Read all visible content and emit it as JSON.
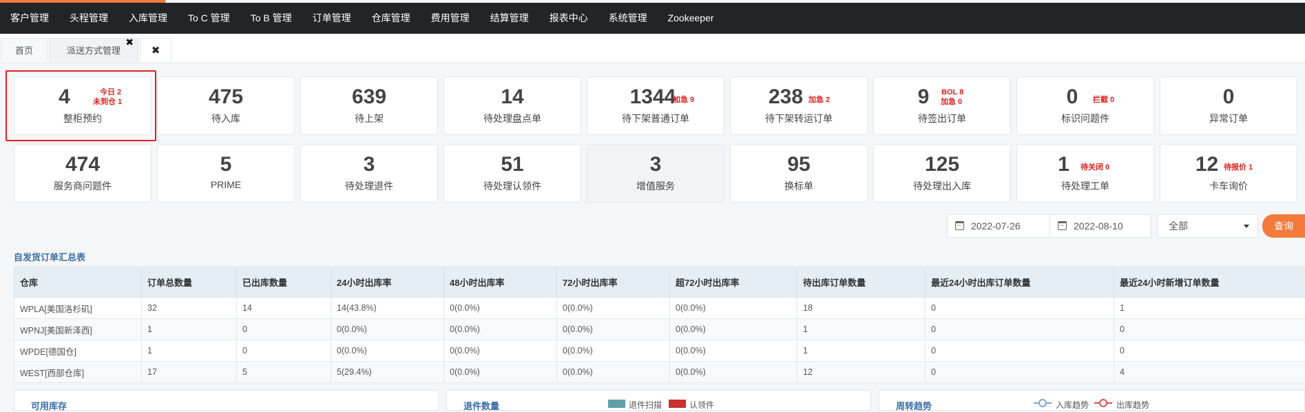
{
  "nav": [
    "客户管理",
    "头程管理",
    "入库管理",
    "To C 管理",
    "To B 管理",
    "订单管理",
    "仓库管理",
    "费用管理",
    "结算管理",
    "报表中心",
    "系统管理",
    "Zookeeper"
  ],
  "tabs": {
    "home": "首页",
    "dispatch": "派送方式管理",
    "close_mark": "✖",
    "close_all": "✖"
  },
  "cards": [
    {
      "value": "4",
      "label": "整柜预约",
      "extra": [
        "今日 2",
        "未到仓 1"
      ]
    },
    {
      "value": "475",
      "label": "待入库"
    },
    {
      "value": "639",
      "label": "待上架"
    },
    {
      "value": "14",
      "label": "待处理盘点单"
    },
    {
      "value": "1344",
      "label": "待下架普通订单",
      "extra": [
        "加急 9"
      ]
    },
    {
      "value": "238",
      "label": "待下架转运订单",
      "extra": [
        "加急 2"
      ]
    },
    {
      "value": "9",
      "label": "待签出订单",
      "extra": [
        "BOL 8",
        "加急 0"
      ]
    },
    {
      "value": "0",
      "label": "标识问题件",
      "extra": [
        "拦截 0"
      ]
    },
    {
      "value": "0",
      "label": "异常订单"
    },
    {
      "value": "474",
      "label": "服务商问题件"
    },
    {
      "value": "5",
      "label": "PRIME"
    },
    {
      "value": "3",
      "label": "待处理退件"
    },
    {
      "value": "51",
      "label": "待处理认领件"
    },
    {
      "value": "3",
      "label": "增值服务"
    },
    {
      "value": "95",
      "label": "换标单"
    },
    {
      "value": "125",
      "label": "待处理出入库"
    },
    {
      "value": "1",
      "label": "待处理工单",
      "extra": [
        "待关闭 0"
      ]
    },
    {
      "value": "12",
      "label": "卡车询价",
      "extra": [
        "待报价 1"
      ]
    }
  ],
  "filters": {
    "start_date": "2022-07-26",
    "end_date": "2022-08-10",
    "status": "全部",
    "query": "查询"
  },
  "summary": {
    "title": "自发货订单汇总表",
    "headers": [
      "仓库",
      "订单总数量",
      "已出库数量",
      "24小时出库率",
      "48小时出库率",
      "72小时出库率",
      "超72小时出库率",
      "待出库订单数量",
      "最近24小时出库订单数量",
      "最近24小时新增订单数量"
    ],
    "rows": [
      [
        "WPLA[美国洛杉矶]",
        "32",
        "14",
        "14(43.8%)",
        "0(0.0%)",
        "0(0.0%)",
        "0(0.0%)",
        "18",
        "0",
        "1"
      ],
      [
        "WPNJ[美国新泽西]",
        "1",
        "0",
        "0(0.0%)",
        "0(0.0%)",
        "0(0.0%)",
        "0(0.0%)",
        "1",
        "0",
        "0"
      ],
      [
        "WPDE[德国仓]",
        "1",
        "0",
        "0(0.0%)",
        "0(0.0%)",
        "0(0.0%)",
        "0(0.0%)",
        "1",
        "0",
        "0"
      ],
      [
        "WEST[西部仓库]",
        "17",
        "5",
        "5(29.4%)",
        "0(0.0%)",
        "0(0.0%)",
        "0(0.0%)",
        "12",
        "0",
        "4"
      ]
    ]
  },
  "panels": {
    "inventory": "可用库存",
    "returns": "退件数量",
    "returns_legend": [
      "退件扫描",
      "认领件"
    ],
    "returns_colors": [
      "#5fa0a8",
      "#c9302c"
    ],
    "trend": "周转趋势",
    "trend_legend": [
      "入库趋势",
      "出库趋势"
    ],
    "trend_colors": [
      "#7aa6d8",
      "#d9534f"
    ]
  },
  "colors": {
    "accent": "#f47a3b",
    "alert": "#e02020",
    "nav_bg": "#222427"
  }
}
